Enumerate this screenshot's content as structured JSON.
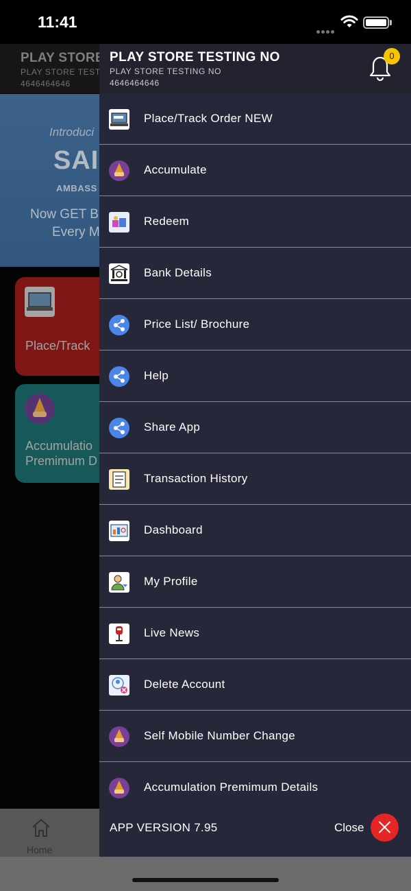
{
  "status_bar": {
    "time": "11:41"
  },
  "background": {
    "header": {
      "title": "PLAY STORE",
      "subtitle": "PLAY STORE TEST",
      "phone": "4646464646"
    },
    "banner": {
      "intro": "Introduci",
      "logo": "SAI",
      "ambassador": "AMBASS",
      "line1": "Now GET B",
      "line2": "Every M"
    },
    "cards": [
      {
        "label": "Place/Track"
      },
      {
        "label_line1": "Accumulatio",
        "label_line2": "Premimum D"
      }
    ],
    "tabbar": {
      "home_label": "Home"
    }
  },
  "drawer": {
    "header": {
      "title": "PLAY STORE TESTING NO",
      "subtitle": "PLAY STORE TESTING NO",
      "phone": "4646464646",
      "notification_count": "0"
    },
    "items": [
      {
        "label": "Place/Track Order NEW",
        "icon": "laptop-icon"
      },
      {
        "label": "Accumulate",
        "icon": "wizard-icon"
      },
      {
        "label": "Redeem",
        "icon": "gift-icon"
      },
      {
        "label": "Bank Details",
        "icon": "bank-icon"
      },
      {
        "label": "Price List/ Brochure",
        "icon": "share-icon"
      },
      {
        "label": "Help",
        "icon": "share-icon"
      },
      {
        "label": "Share App",
        "icon": "share-icon"
      },
      {
        "label": "Transaction History",
        "icon": "history-icon"
      },
      {
        "label": "Dashboard",
        "icon": "dashboard-icon"
      },
      {
        "label": "My Profile",
        "icon": "profile-edit-icon"
      },
      {
        "label": "Live News",
        "icon": "microphone-icon"
      },
      {
        "label": "Delete Account",
        "icon": "delete-user-icon"
      },
      {
        "label": "Self Mobile Number Change",
        "icon": "wizard-icon"
      },
      {
        "label": "Accumulation Premimum Details",
        "icon": "wizard-icon"
      }
    ],
    "footer": {
      "version": "APP VERSION 7.95",
      "close_label": "Close"
    }
  },
  "colors": {
    "drawer_bg": "#27273a",
    "badge": "#f7c400",
    "close": "#e52626",
    "banner": "#4a78a8",
    "card_red": "#9a1b1b",
    "card_teal": "#1d6c6c"
  }
}
